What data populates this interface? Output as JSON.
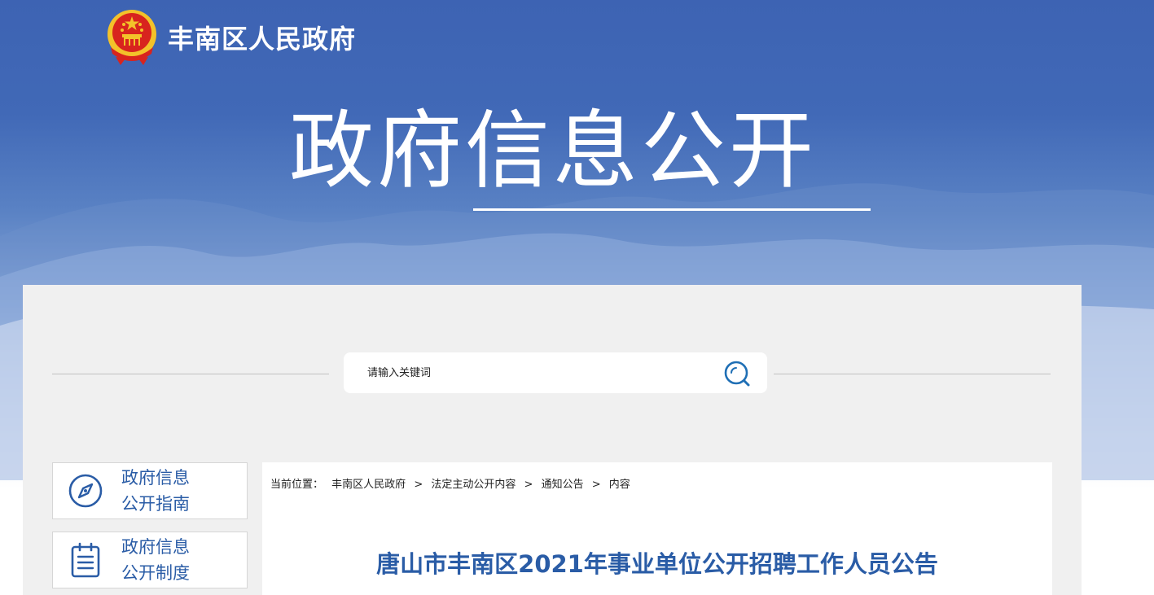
{
  "header": {
    "site_name": "丰南区人民政府",
    "section_title": "政府信息公开"
  },
  "search": {
    "placeholder": "请输入关键词"
  },
  "sidebar": {
    "items": [
      {
        "line1": "政府信息",
        "line2": "公开指南",
        "icon": "compass-icon"
      },
      {
        "line1": "政府信息",
        "line2": "公开制度",
        "icon": "clipboard-icon"
      }
    ]
  },
  "breadcrumb": {
    "prefix": "当前位置：",
    "items": [
      "丰南区人民政府",
      "法定主动公开内容",
      "通知公告",
      "内容"
    ],
    "separator": ">"
  },
  "article": {
    "title": "唐山市丰南区2021年事业单位公开招聘工作人员公告"
  },
  "colors": {
    "banner_blue": "#3d63b3",
    "accent_blue": "#2a5ca6",
    "panel_gray": "#f0f0f0",
    "emblem_red": "#d8241e",
    "emblem_gold": "#f3c22a"
  }
}
